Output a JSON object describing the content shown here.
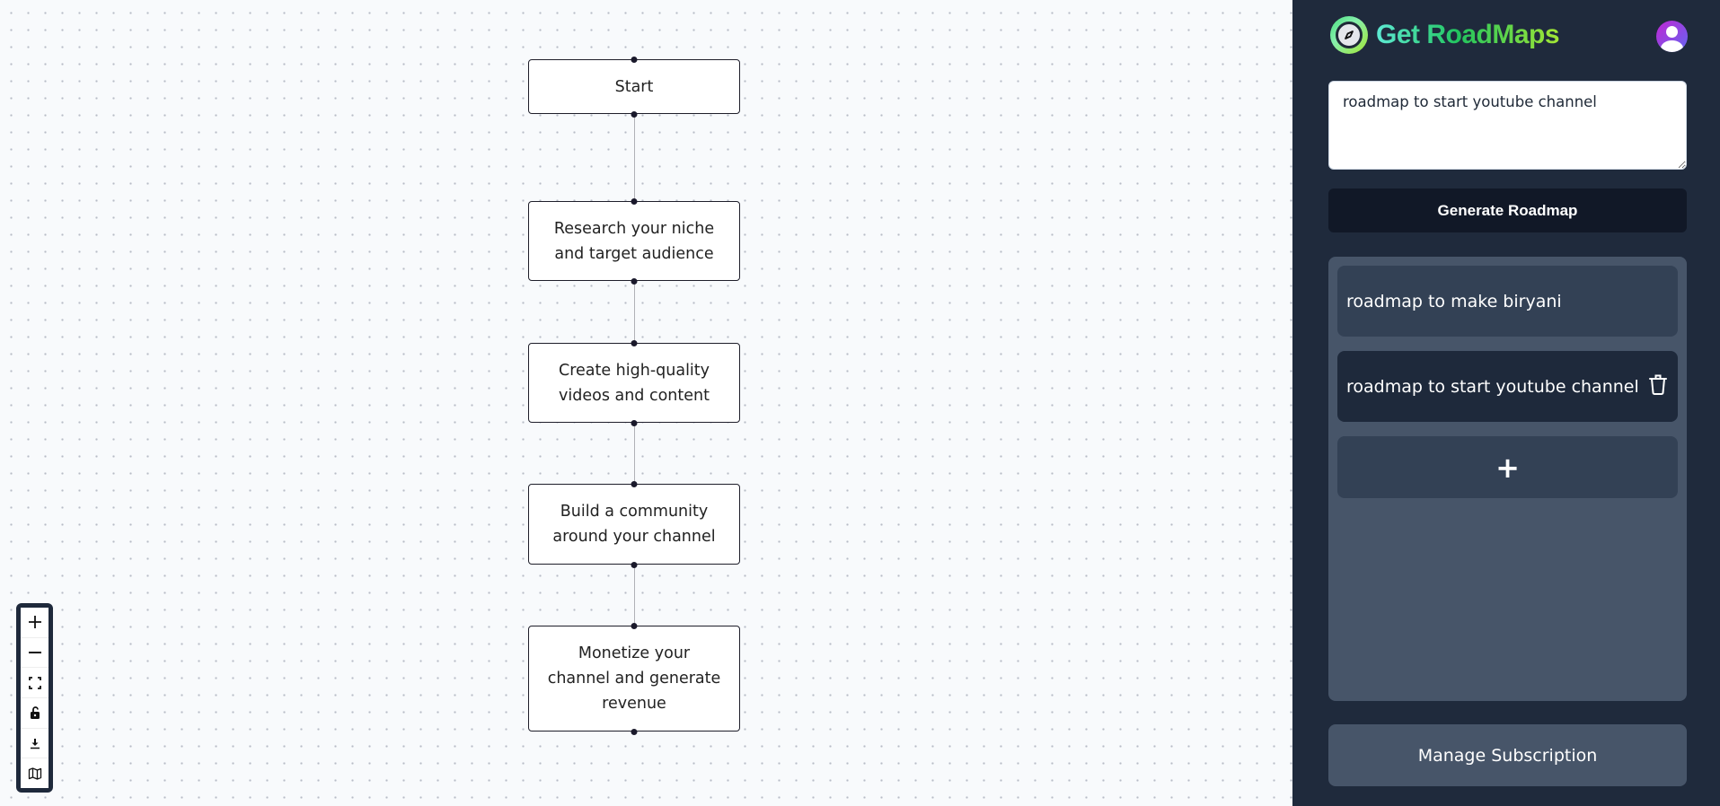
{
  "canvas": {
    "nodes": [
      {
        "id": "start",
        "label": "Start"
      },
      {
        "id": "research",
        "label": "Research your niche and target audience"
      },
      {
        "id": "create",
        "label": "Create high-quality videos and content"
      },
      {
        "id": "build",
        "label": "Build a community around your channel"
      },
      {
        "id": "monetize",
        "label": "Monetize your channel and generate revenue"
      }
    ],
    "controls": [
      {
        "name": "zoom-in",
        "icon": "plus-icon"
      },
      {
        "name": "zoom-out",
        "icon": "minus-icon"
      },
      {
        "name": "fit-view",
        "icon": "fit-view-icon"
      },
      {
        "name": "toggle-lock",
        "icon": "unlock-icon"
      },
      {
        "name": "download",
        "icon": "download-icon"
      },
      {
        "name": "minimap",
        "icon": "map-icon"
      }
    ]
  },
  "sidebar": {
    "brand": {
      "title": "Get RoadMaps",
      "logo_icon": "compass-icon"
    },
    "avatar_icon": "user-icon",
    "prompt": {
      "value": "roadmap to start youtube channel"
    },
    "generate_label": "Generate Roadmap",
    "history": [
      {
        "label": "roadmap to make biryani",
        "active": false
      },
      {
        "label": "roadmap to start youtube channel",
        "active": true
      }
    ],
    "add_label": "+",
    "manage_label": "Manage Subscription"
  },
  "colors": {
    "sidebar_bg": "#1f2a3c",
    "panel_bg": "#475569",
    "item_bg": "#334155",
    "active_item_bg": "#1e293b",
    "generate_bg": "#111827",
    "canvas_bg": "#f8fafc",
    "brand_gradient": [
      "#5eead4",
      "#22c55e",
      "#a3e635"
    ]
  }
}
